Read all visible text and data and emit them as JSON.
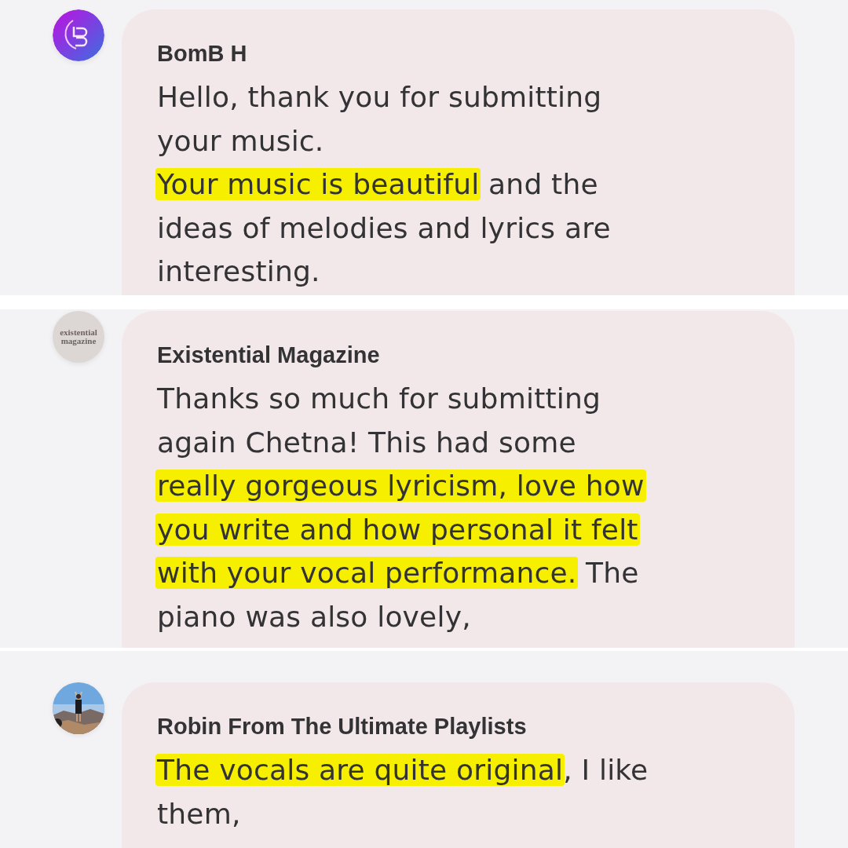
{
  "messages": [
    {
      "avatar": {
        "kind": "logo"
      },
      "sender": "BomB H",
      "lines": [
        [
          {
            "text": "Hello, thank you for submitting",
            "highlighted": false
          }
        ],
        [
          {
            "text": "your music.",
            "highlighted": false
          }
        ],
        [
          {
            "text": "Your music is beautiful",
            "highlighted": true
          },
          {
            "text": " and the",
            "highlighted": false
          }
        ],
        [
          {
            "text": "ideas of melodies and lyrics are",
            "highlighted": false
          }
        ],
        [
          {
            "text": "interesting.",
            "highlighted": false
          }
        ]
      ]
    },
    {
      "avatar": {
        "kind": "text",
        "text": "existential magazine"
      },
      "sender": "Existential Magazine",
      "lines": [
        [
          {
            "text": "Thanks so much for submitting",
            "highlighted": false
          }
        ],
        [
          {
            "text": "again Chetna! This had some",
            "highlighted": false
          }
        ],
        [
          {
            "text": "really gorgeous lyricism, love how",
            "highlighted": true
          }
        ],
        [
          {
            "text": "you write and how personal it felt",
            "highlighted": true
          }
        ],
        [
          {
            "text": "with your vocal performance.",
            "highlighted": true
          },
          {
            "text": " The",
            "highlighted": false
          }
        ],
        [
          {
            "text": "piano was also lovely,",
            "highlighted": false
          }
        ]
      ]
    },
    {
      "avatar": {
        "kind": "picture"
      },
      "sender": "Robin From The Ultimate Playlists",
      "lines": [
        [
          {
            "text": "The vocals are quite original",
            "highlighted": true
          },
          {
            "text": ", I like",
            "highlighted": false
          }
        ],
        [
          {
            "text": "them,",
            "highlighted": false
          }
        ]
      ]
    }
  ]
}
